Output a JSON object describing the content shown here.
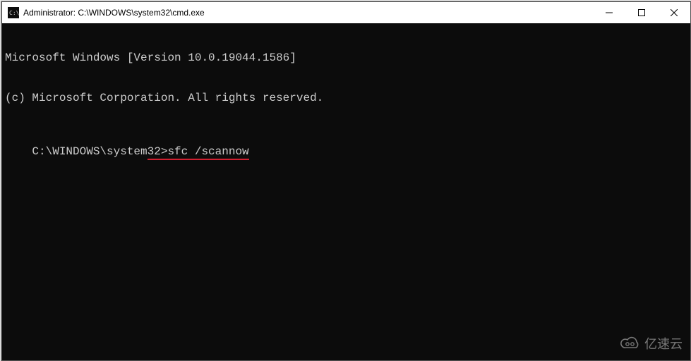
{
  "titlebar": {
    "icon": "cmd-icon",
    "title": "Administrator: C:\\WINDOWS\\system32\\cmd.exe",
    "controls": {
      "minimize": "minimize",
      "maximize": "maximize",
      "close": "close"
    }
  },
  "terminal": {
    "line1": "Microsoft Windows [Version 10.0.19044.1586]",
    "line2": "(c) Microsoft Corporation. All rights reserved.",
    "blank": "",
    "prompt": "C:\\WINDOWS\\system32>",
    "command": "sfc /scannow",
    "highlight_target": "sfc /scannow"
  },
  "watermark": {
    "text": "亿速云"
  }
}
